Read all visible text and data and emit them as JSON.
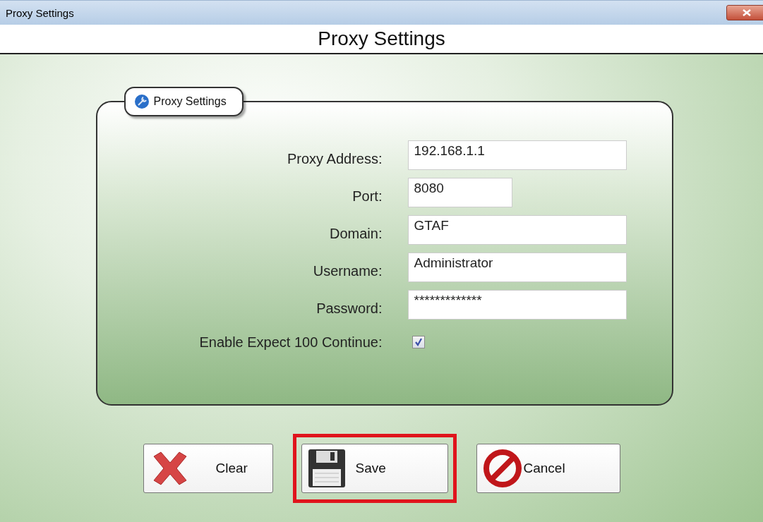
{
  "window": {
    "title": "Proxy Settings"
  },
  "header": {
    "title": "Proxy Settings"
  },
  "group": {
    "title": "Proxy Settings"
  },
  "fields": [
    {
      "kind": "text",
      "label": "Proxy Address:",
      "value": "192.168.1.1"
    },
    {
      "kind": "number",
      "label": "Port:",
      "value": "8080"
    },
    {
      "kind": "text",
      "label": "Domain:",
      "value": "GTAF"
    },
    {
      "kind": "text",
      "label": "Username:",
      "value": "Administrator"
    },
    {
      "kind": "password",
      "label": "Password:",
      "value": "*************"
    },
    {
      "kind": "checkbox",
      "label": "Enable Expect 100 Continue:",
      "checked": true
    }
  ],
  "buttons": [
    {
      "kind": "clear",
      "label": "Clear",
      "highlighted": false
    },
    {
      "kind": "save",
      "label": "Save",
      "highlighted": true
    },
    {
      "kind": "cancel",
      "label": "Cancel",
      "highlighted": false
    }
  ]
}
